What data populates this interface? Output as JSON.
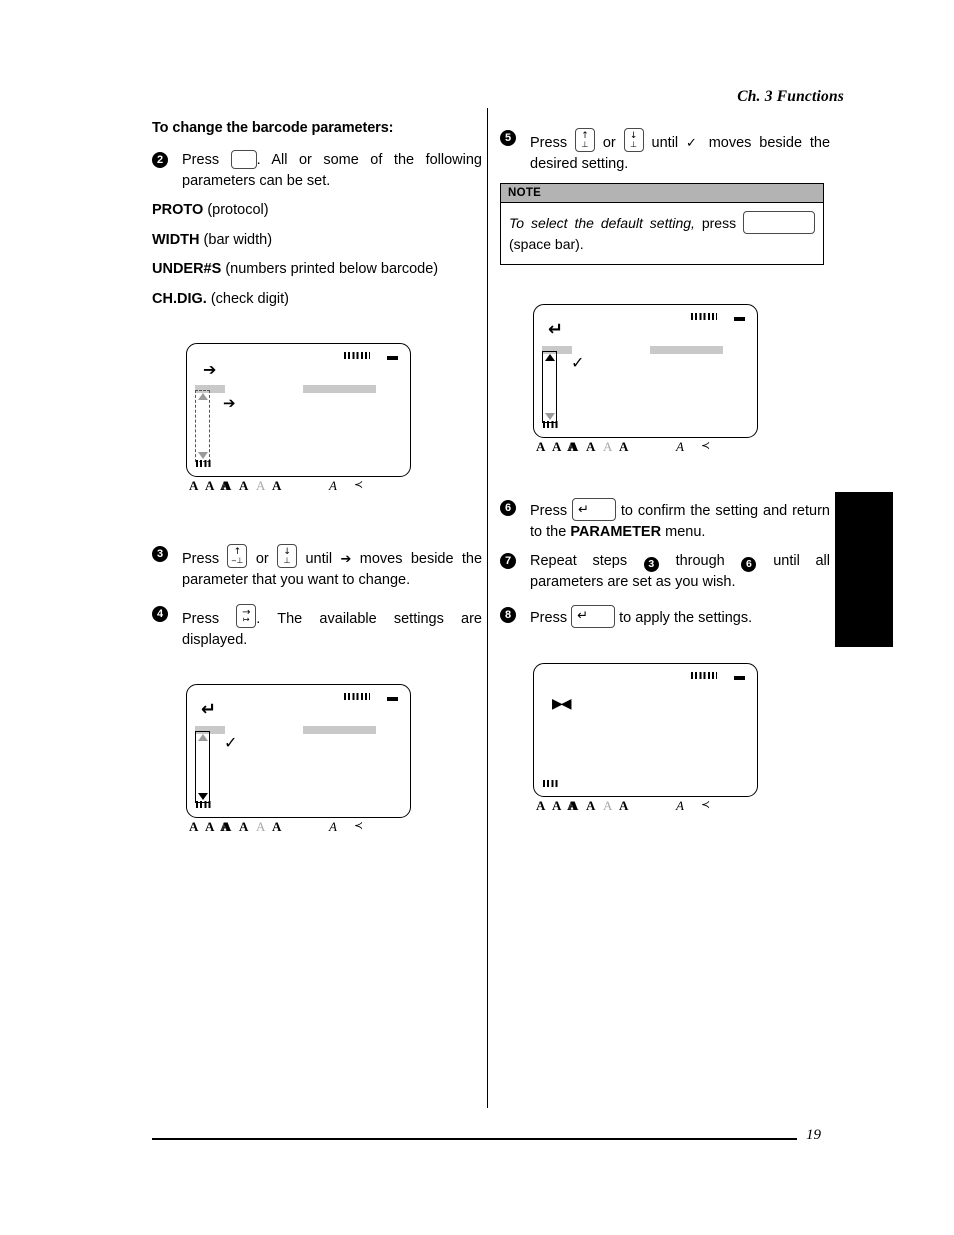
{
  "header": {
    "running_head": "Ch. 3 Functions"
  },
  "footer": {
    "page_number": "19"
  },
  "left_column": {
    "heading": "To change the barcode parameters:",
    "step2": {
      "number": "2",
      "text_before": "Press",
      "key": "blank-key",
      "text_after": ". All or some of the following parameters can be set."
    },
    "parameters": [
      {
        "name": "PROTO",
        "desc": "(protocol)"
      },
      {
        "name": "WIDTH",
        "desc": "(bar width)"
      },
      {
        "name": "UNDER#S",
        "desc": "(numbers printed below barcode)"
      },
      {
        "name": "CH.DIG.",
        "desc": "(check digit)"
      }
    ],
    "step3": {
      "number": "3",
      "t1": "Press",
      "key_up": "up-arrow-key",
      "t2": "or",
      "key_down": "down-arrow-key",
      "t3": "until",
      "glyph": "➔",
      "t4": "moves beside the parameter that you want to change."
    },
    "step4": {
      "number": "4",
      "t1": "Press",
      "key_right": "right-arrow-key",
      "t2": ". The available settings are displayed."
    }
  },
  "right_column": {
    "step5": {
      "number": "5",
      "t1": "Press",
      "key_up": "up-arrow-key",
      "t2": "or",
      "key_down": "down-arrow-key",
      "t3": "until",
      "glyph": "✓",
      "t4": "moves beside the desired setting."
    },
    "note": {
      "title": "NOTE",
      "t1": "To select the default setting,",
      "t2": "press",
      "key": "space-bar-key",
      "t3": "(space bar)."
    },
    "step6": {
      "number": "6",
      "t1": "Press",
      "key_enter": "enter-key",
      "t2": "to confirm the setting and return to the",
      "bold": "PARAMETER",
      "t3": "menu."
    },
    "step7": {
      "number": "7",
      "t1": "Repeat steps",
      "ref_a": "3",
      "t2": "through",
      "ref_b": "6",
      "t3": "until all parameters are set as you wish."
    },
    "step8": {
      "number": "8",
      "t1": "Press",
      "key_enter": "enter-key",
      "t2": "to apply the settings."
    }
  },
  "lcd_displays": [
    {
      "id": "lcd-parameter-menu",
      "cursor_glyph": "➔",
      "second_glyph": "➔",
      "scrollbar": "dashed",
      "scroll_top_triangle": "outline-up",
      "scroll_bottom_triangle": "outline-down",
      "top_bars": "signal-bars",
      "battery": "battery-icon"
    },
    {
      "id": "lcd-setting-list-top",
      "cursor_glyph": "↵",
      "second_glyph": "✓",
      "scrollbar": "solid",
      "scroll_top_triangle": "filled-up",
      "scroll_bottom_triangle": "outline-down",
      "top_bars": "signal-bars",
      "battery": "battery-icon"
    },
    {
      "id": "lcd-setting-list-bottom",
      "cursor_glyph": "↵",
      "second_glyph": "✓",
      "scrollbar": "solid",
      "scroll_top_triangle": "outline-up",
      "scroll_bottom_triangle": "filled-down",
      "top_bars": "signal-bars",
      "battery": "battery-icon"
    },
    {
      "id": "lcd-applied",
      "cursor_glyph": "▶◀",
      "second_glyph": "",
      "scrollbar": "none",
      "top_bars": "signal-bars",
      "battery": "battery-icon"
    }
  ],
  "lcd_status_indicators": [
    "A",
    "A",
    "A",
    "A",
    "A",
    "A",
    "A",
    "≺"
  ]
}
